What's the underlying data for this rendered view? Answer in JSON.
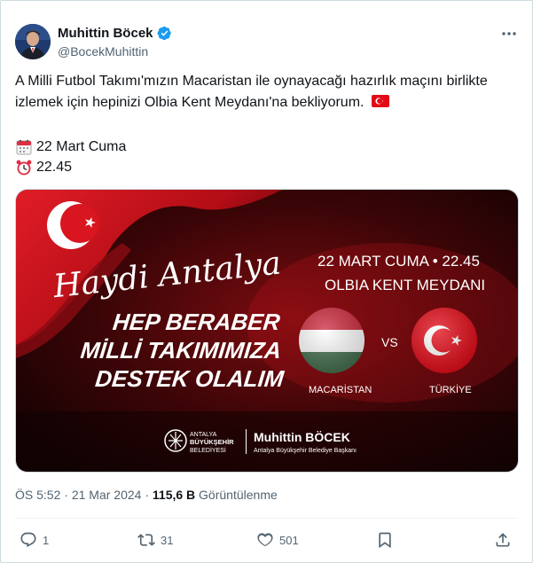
{
  "user": {
    "name": "Muhittin Böcek",
    "handle": "@BocekMuhittin"
  },
  "tweet": {
    "text": "A Milli Futbol Takımı'mızın Macaristan ile oynayacağı hazırlık maçını birlikte izlemek için hepinizi Olbia Kent Meydanı'na bekliyorum.",
    "date_line": "22 Mart Cuma",
    "time_line": "22.45"
  },
  "media": {
    "script_title": "Haydi Antalya",
    "slogan_1": "HEP BERABER",
    "slogan_2": "MİLLİ TAKIMIMIZA",
    "slogan_3": "DESTEK OLALIM",
    "event_date": "22 MART CUMA • 22.45",
    "event_place": "OLBIA KENT MEYDANI",
    "team_left": "MACARİSTAN",
    "team_right": "TÜRKİYE",
    "vs": "VS",
    "org_1": "ANTALYA",
    "org_2": "BÜYÜKŞEHİR",
    "org_3": "BELEDİYESİ",
    "mayor_name": "Muhittin BÖCEK",
    "mayor_title": "Antalya Büyükşehir Belediye Başkanı"
  },
  "meta": {
    "time": "ÖS 5:52",
    "sep": "·",
    "date": "21 Mar 2024",
    "views_count": "115,6 B",
    "views_label": "Görüntülenme"
  },
  "actions": {
    "replies": "1",
    "retweets": "31",
    "likes": "501"
  },
  "colors": {
    "accent": "#1d9bf0",
    "red": "#e30a17"
  }
}
